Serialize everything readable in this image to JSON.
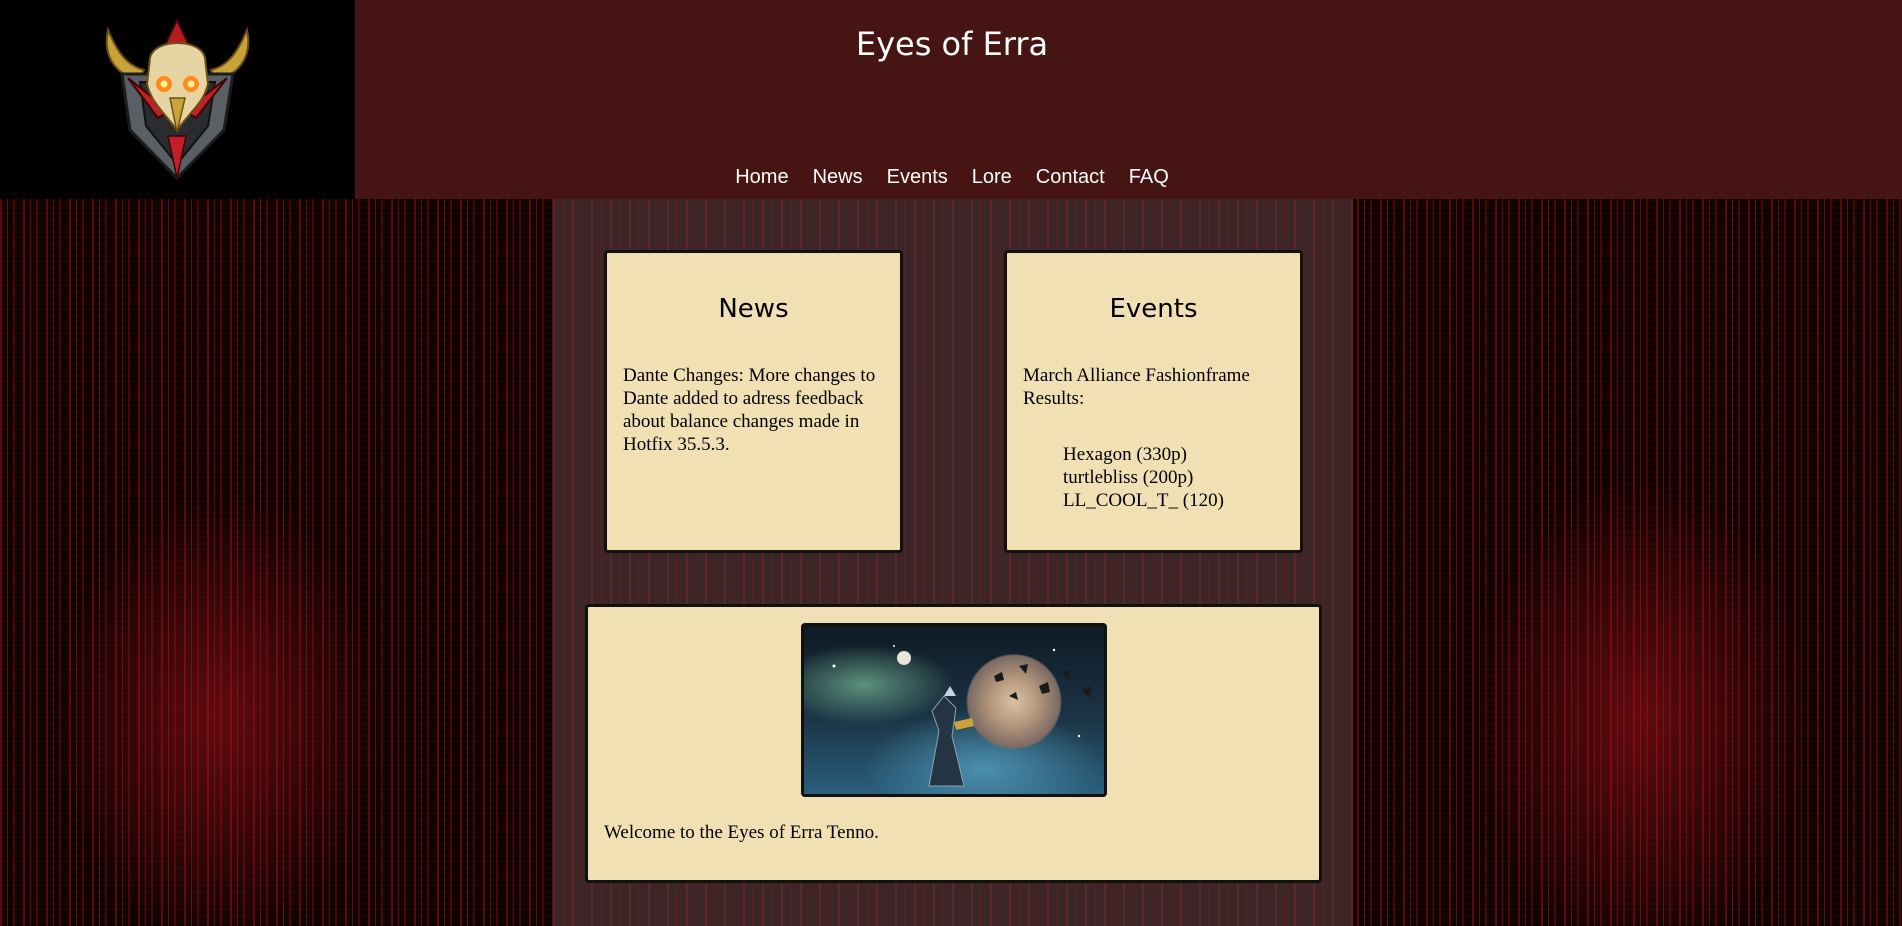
{
  "site": {
    "title": "Eyes of Erra"
  },
  "nav": {
    "items": [
      "Home",
      "News",
      "Events",
      "Lore",
      "Contact",
      "FAQ"
    ]
  },
  "news": {
    "title": "News",
    "text": "Dante Changes: More changes to Dante added to adress feedback about balance changes made in Hotfix 35.5.3."
  },
  "events": {
    "title": "Events",
    "text": "March Alliance Fashionframe Results:",
    "results": [
      "Hexagon (330p)",
      "turtlebliss (200p)",
      "LL_COOL_T_ (120)"
    ]
  },
  "welcome": {
    "text": "Welcome to the Eyes of Erra Tenno."
  },
  "icons": {
    "logo": "crested-skull-emblem-logo",
    "banner": "space-warframe-banner-image"
  },
  "colors": {
    "header_bg": "#471414",
    "logo_bg": "#000000",
    "card_bg": "#f0e0b3",
    "card_border": "#111111",
    "nav_text": "#ffffff"
  }
}
